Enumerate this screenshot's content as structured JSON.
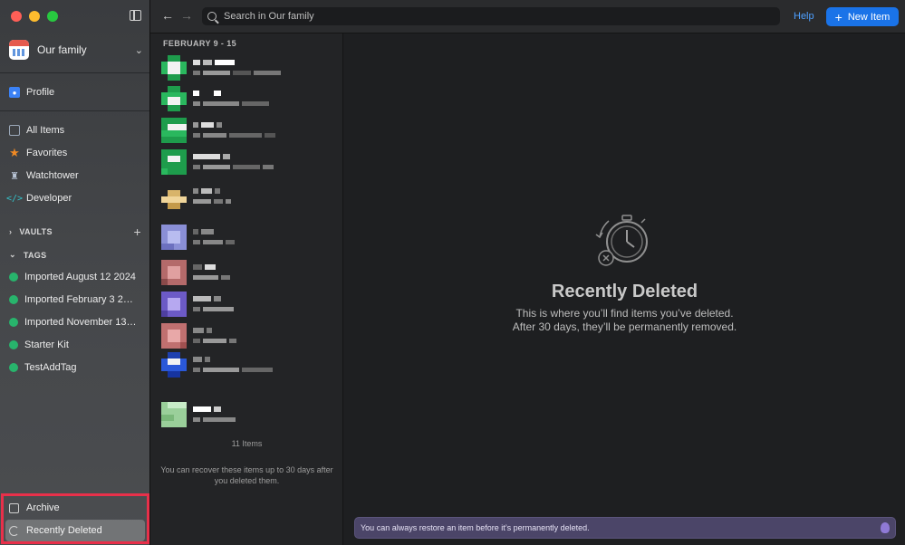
{
  "window": {
    "toggle_sidebar": "toggle-sidebar"
  },
  "account": {
    "name": "Our family"
  },
  "sidebar": {
    "profile": "Profile",
    "items": [
      {
        "label": "All Items",
        "icon": "all-items-icon"
      },
      {
        "label": "Favorites",
        "icon": "star-icon"
      },
      {
        "label": "Watchtower",
        "icon": "watchtower-icon"
      },
      {
        "label": "Developer",
        "icon": "code-icon"
      }
    ],
    "vaults_label": "VAULTS",
    "tags_label": "TAGS",
    "tags": [
      "Imported August 12 2024",
      "Imported February 3 2024",
      "Imported November 13 2023",
      "Starter Kit",
      "TestAddTag"
    ],
    "archive": "Archive",
    "recently_deleted": "Recently Deleted"
  },
  "toolbar": {
    "search_placeholder": "Search in Our family",
    "help": "Help",
    "new_item": "New Item"
  },
  "list": {
    "date_header": "FEBRUARY 9 - 15",
    "count": "11 Items",
    "recover_note": "You can recover these items up to 30 days after you deleted them."
  },
  "detail": {
    "title": "Recently Deleted",
    "line1": "This is where you’ll find items you’ve deleted.",
    "line2": "After 30 days, they’ll be permanently removed."
  },
  "banner": {
    "text": "You can always restore an item before it’s permanently deleted."
  },
  "colors": {
    "accent": "#1a73e8",
    "link": "#4ea0ff",
    "tag": "#28b46c",
    "highlight": "#e8304a"
  }
}
